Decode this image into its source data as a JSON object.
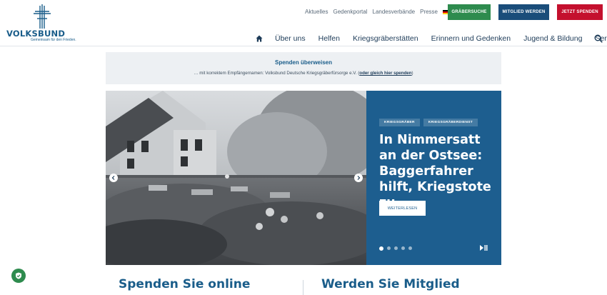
{
  "brand": {
    "name": "VOLKSBUND",
    "tagline": "Gemeinsam für den Frieden."
  },
  "meta_nav": {
    "items": [
      "Aktuelles",
      "Gedenkportal",
      "Landesverbände",
      "Presse"
    ],
    "language": "DE"
  },
  "action_buttons": {
    "grave_search": "Gräbersuche",
    "become_member": "Mitglied werden",
    "donate_now": "Jetzt spenden"
  },
  "main_nav": {
    "items": [
      "Über uns",
      "Helfen",
      "Kriegsgräberstätten",
      "Erinnern und Gedenken",
      "Jugend & Bildung",
      "Service"
    ]
  },
  "notice": {
    "title": "Spenden überweisen",
    "text": "… mit korrektem Empfängernamen: Volksbund Deutsche Kriegsgräberfürsorge e.V. (",
    "link": "oder gleich hier spenden",
    "suffix": ")"
  },
  "slider": {
    "tags": [
      "KRIEGSGRÄBER",
      "KRIEGSGRÄBERDIENST"
    ],
    "headline": "In Nimmersatt an der Ostsee: Bag­gerfahrer hilft, Kriegstote zu…",
    "more_label": "WEITERLESEN",
    "total_slides": 5,
    "active_slide": 1
  },
  "sections": {
    "donate_online": "Spenden Sie online",
    "become_member": "Werden Sie Mitglied"
  },
  "colors": {
    "brand_blue": "#1a5d8a",
    "panel_blue": "#1d5e8f",
    "green": "#2e8b4e",
    "dark_blue": "#1a4d7a",
    "red": "#c4102e"
  }
}
